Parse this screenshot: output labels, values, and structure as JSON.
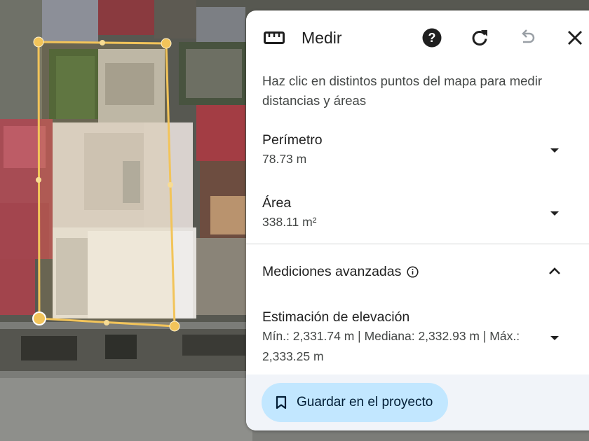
{
  "panel": {
    "title": "Medir",
    "instructions": "Haz clic en distintos puntos del mapa para medir distancias y áreas",
    "perimeter": {
      "label": "Perímetro",
      "value": "78.73 m"
    },
    "area": {
      "label": "Área",
      "value": "338.11 m²"
    },
    "advanced": {
      "label": "Mediciones avanzadas"
    },
    "elevation": {
      "label": "Estimación de elevación",
      "value": "Mín.: 2,331.74 m | Mediana: 2,332.93 m | Máx.: 2,333.25 m"
    },
    "save_button": "Guardar en el proyecto"
  },
  "icons": {
    "ruler": "ruler-icon",
    "help": "help-icon",
    "refresh": "refresh-icon",
    "undo": "undo-icon",
    "close": "close-icon",
    "expand": "chevron-down-icon",
    "collapse": "chevron-up-icon",
    "info": "info-icon",
    "bookmark": "bookmark-icon"
  },
  "colors": {
    "panel_bg": "#ffffff",
    "footer_bg": "#f1f4f9",
    "save_button_bg": "#c2e7ff",
    "measure_line": "#f2c45a",
    "text_primary": "#1f1f1f",
    "text_secondary": "#444746"
  }
}
